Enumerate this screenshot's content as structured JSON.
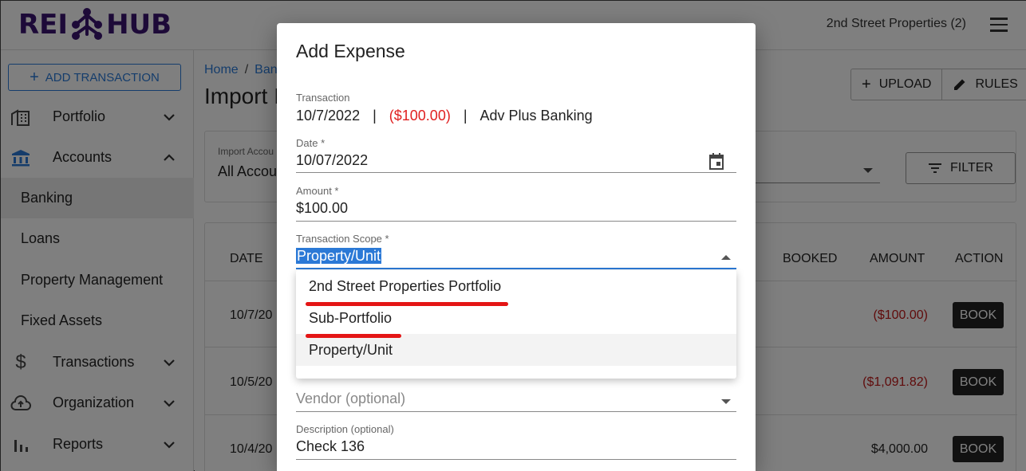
{
  "app": {
    "logo_left": "REI",
    "logo_right": "HUB",
    "org_name": "2nd Street Properties (2)"
  },
  "sidebar": {
    "add_transaction": "ADD TRANSACTION",
    "items": [
      {
        "label": "Portfolio",
        "icon": "building-icon"
      },
      {
        "label": "Accounts",
        "icon": "bank-icon"
      },
      {
        "label": "Transactions",
        "icon": "dollar-icon"
      },
      {
        "label": "Organization",
        "icon": "cloud-upload-icon"
      },
      {
        "label": "Reports",
        "icon": "bar-chart-icon"
      }
    ],
    "sub_items": [
      "Banking",
      "Loans",
      "Property Management",
      "Fixed Assets"
    ]
  },
  "main": {
    "breadcrumb": [
      "Home",
      "Ban"
    ],
    "title": "Import I",
    "upload_label": "UPLOAD",
    "rules_label": "RULES",
    "filter": {
      "label": "Import Accou",
      "value": "All Accou",
      "button": "FILTER"
    },
    "table": {
      "headers": [
        "DATE",
        "BOOKED",
        "AMOUNT",
        "ACTION"
      ],
      "rows": [
        {
          "date": "10/7/20",
          "amount": "($100.00)",
          "negative": true,
          "action": "BOOK"
        },
        {
          "date": "10/5/20",
          "amount": "($1,091.82)",
          "negative": true,
          "action": "BOOK"
        },
        {
          "date": "10/4/20",
          "amount": "$4,000.00",
          "negative": false,
          "action": "BOOK"
        }
      ]
    }
  },
  "modal": {
    "title": "Add Expense",
    "transaction": {
      "label": "Transaction",
      "date": "10/7/2022",
      "separator": "|",
      "amount": "($100.00)",
      "account": "Adv Plus Banking"
    },
    "date": {
      "label": "Date *",
      "value": "10/07/2022"
    },
    "amount": {
      "label": "Amount *",
      "value": "$100.00"
    },
    "scope": {
      "label": "Transaction Scope *",
      "value": "Property/Unit",
      "options": [
        "2nd Street Properties Portfolio",
        "Sub-Portfolio",
        "Property/Unit"
      ]
    },
    "vendor": {
      "placeholder": "Vendor (optional)"
    },
    "description": {
      "label": "Description (optional)",
      "value": "Check 136"
    }
  },
  "colors": {
    "brand": "#3b1470",
    "accent": "#2b79d6",
    "negative": "#e02020",
    "annotation": "#e41515"
  }
}
